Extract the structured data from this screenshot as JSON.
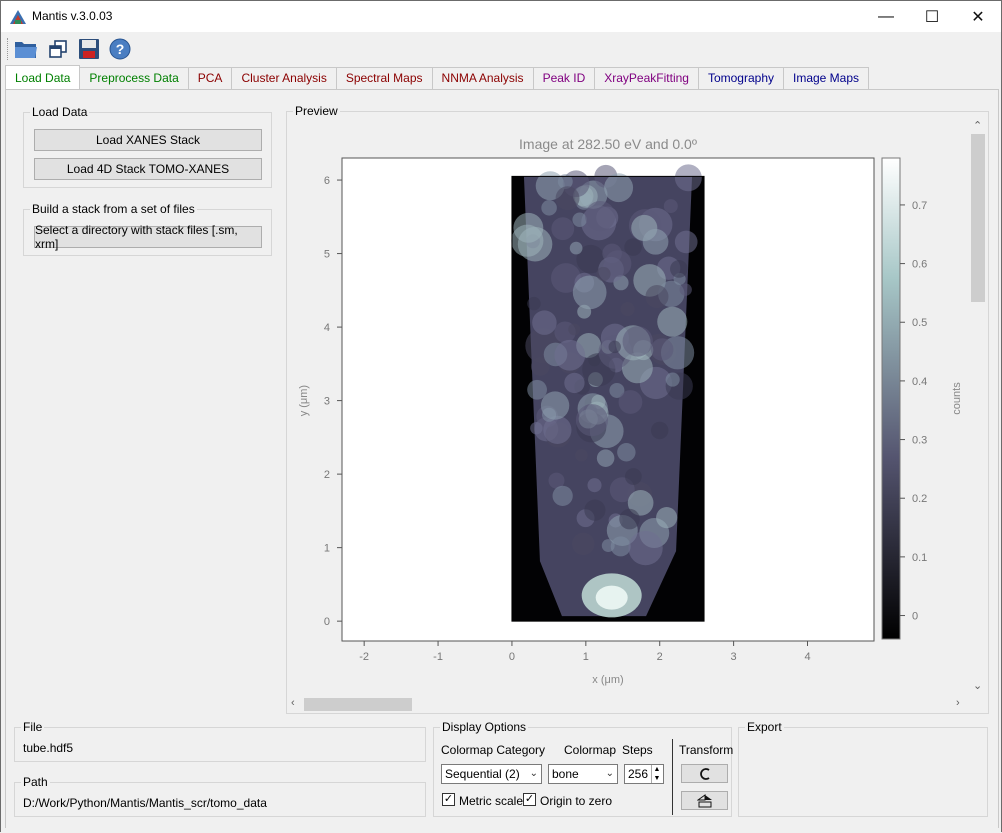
{
  "window": {
    "title": "Mantis v.3.0.03",
    "minimize_glyph": "—",
    "maximize_glyph": "☐",
    "close_glyph": "✕"
  },
  "toolbar": {
    "icons": [
      "open-folder-icon",
      "copy-windows-icon",
      "save-disk-icon",
      "help-icon"
    ]
  },
  "tabs": [
    {
      "label": "Load Data",
      "color": "#008000",
      "active": true
    },
    {
      "label": "Preprocess Data",
      "color": "#008000"
    },
    {
      "label": "PCA",
      "color": "#8b0000"
    },
    {
      "label": "Cluster Analysis",
      "color": "#8b0000"
    },
    {
      "label": "Spectral Maps",
      "color": "#8b0000"
    },
    {
      "label": "NNMA Analysis",
      "color": "#8b0000"
    },
    {
      "label": "Peak ID",
      "color": "#800080"
    },
    {
      "label": "XrayPeakFitting",
      "color": "#800080"
    },
    {
      "label": "Tomography",
      "color": "#00008b"
    },
    {
      "label": "Image Maps",
      "color": "#00008b"
    }
  ],
  "load_data": {
    "group_title": "Load Data",
    "load_xanes_button": "Load XANES Stack",
    "load_4d_button": "Load 4D Stack TOMO-XANES"
  },
  "build_stack": {
    "group_title": "Build a stack from a set of files",
    "select_dir_button": "Select a directory with stack files [.sm, xrm]"
  },
  "preview": {
    "group_title": "Preview"
  },
  "chart_data": {
    "type": "heatmap",
    "title": "Image at 282.50 eV and 0.0º",
    "xlabel": "x (μm)",
    "ylabel": "y (μm)",
    "xlim": [
      -2.3,
      4.9
    ],
    "ylim": [
      -0.27,
      6.3
    ],
    "xticks": [
      "-2",
      "-1",
      "0",
      "1",
      "2",
      "3",
      "4"
    ],
    "xtick_values": [
      -2,
      -1,
      0,
      1,
      2,
      3,
      4
    ],
    "yticks": [
      "0",
      "1",
      "2",
      "3",
      "4",
      "5",
      "6"
    ],
    "ytick_values": [
      0,
      1,
      2,
      3,
      4,
      5,
      6
    ],
    "image_extent": {
      "x": [
        0,
        2.6
      ],
      "y": [
        0,
        6.05
      ]
    },
    "colormap": "bone",
    "colorbar": {
      "label": "counts",
      "ticks": [
        "0",
        "0.1",
        "0.2",
        "0.3",
        "0.4",
        "0.5",
        "0.6",
        "0.7"
      ],
      "tick_values": [
        0,
        0.1,
        0.2,
        0.3,
        0.4,
        0.5,
        0.6,
        0.7
      ],
      "range": [
        -0.04,
        0.78
      ]
    }
  },
  "file": {
    "group_title": "File",
    "value": "tube.hdf5"
  },
  "path": {
    "group_title": "Path",
    "value": "D:/Work/Python/Mantis/Mantis_scr/tomo_data"
  },
  "display_options": {
    "group_title": "Display Options",
    "colormap_category_label": "Colormap Category",
    "colormap_label": "Colormap",
    "steps_label": "Steps",
    "transform_label": "Transform",
    "colormap_category_value": "Sequential (2)",
    "colormap_value": "bone",
    "steps_value": "256",
    "metric_scale_label": "Metric scale",
    "origin_to_zero_label": "Origin to zero",
    "metric_scale_checked": true,
    "origin_to_zero_checked": true
  },
  "export": {
    "group_title": "Export"
  }
}
